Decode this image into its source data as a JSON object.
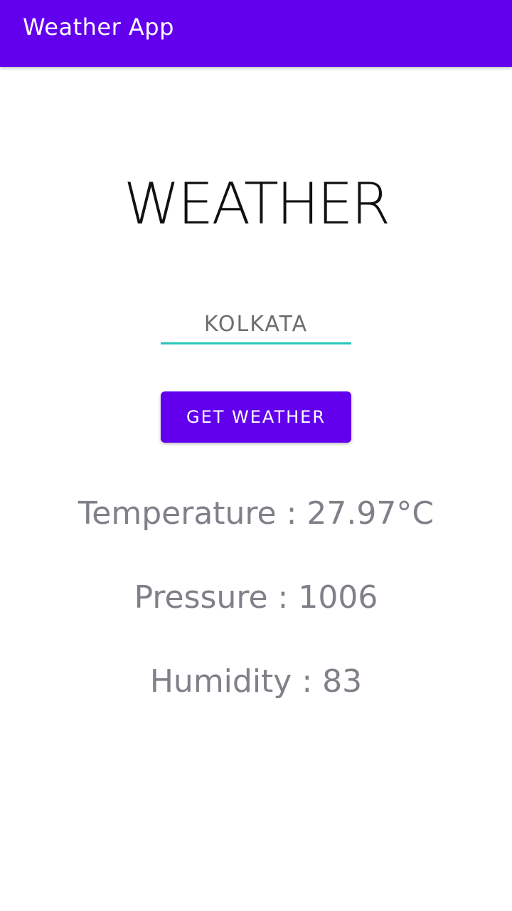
{
  "app_bar": {
    "title": "Weather App",
    "color": "#6200ee"
  },
  "main": {
    "heading": "WEATHER",
    "city_input": {
      "value": "KOLKATA",
      "underline_color": "#26c6b8"
    },
    "get_weather_button": {
      "label": "GET WEATHER"
    },
    "readings": {
      "temperature": "Temperature : 27.97°C",
      "pressure": "Pressure : 1006",
      "humidity": "Humidity : 83"
    }
  }
}
